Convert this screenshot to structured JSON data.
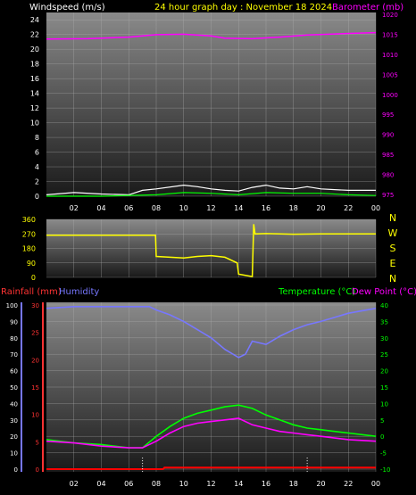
{
  "header": {
    "windspeed_label": "Windspeed (m/s)",
    "graph_title": "24 hour graph day : November 18 2024",
    "barometer_label": "Barometer (mb)"
  },
  "colors": {
    "background": "#000000",
    "wind_speed": "#ffffff",
    "wind_gust": "#00ff00",
    "barometer": "#ff00ff",
    "wind_direction": "#ffff00",
    "rainfall": "#ff0000",
    "humidity": "#7777ff",
    "temperature": "#00ff00",
    "dew_point": "#ff00ff",
    "title": "#ffff00",
    "axis_text": "#ffffff"
  },
  "chart_data": [
    {
      "type": "line",
      "name": "wind-barometer",
      "x_ticks": [
        "02",
        "04",
        "06",
        "08",
        "10",
        "12",
        "14",
        "16",
        "18",
        "20",
        "22",
        "00"
      ],
      "ylabel_left": "Windspeed (m/s)",
      "ylim_left": [
        0,
        25
      ],
      "yticks_left": [
        0,
        2,
        4,
        6,
        8,
        10,
        12,
        14,
        16,
        18,
        20,
        22,
        24
      ],
      "ylabel_right": "Barometer (mb)",
      "ylim_right": [
        975,
        1020
      ],
      "yticks_right": [
        975,
        980,
        985,
        990,
        995,
        1000,
        1005,
        1010,
        1015,
        1020
      ],
      "grid": true,
      "series": [
        {
          "axis": "right",
          "color": "#ff00ff",
          "x": [
            0,
            3,
            6,
            8,
            10,
            12,
            13,
            15,
            17,
            19,
            22,
            24
          ],
          "values": [
            1013.8,
            1013.9,
            1014.3,
            1014.9,
            1015.0,
            1014.6,
            1014.0,
            1013.9,
            1014.3,
            1014.8,
            1015.2,
            1015.4
          ]
        },
        {
          "axis": "left",
          "color": "#ffffff",
          "x": [
            0,
            2,
            4,
            6,
            7,
            8,
            10,
            11,
            12,
            13,
            14,
            15,
            16,
            17,
            18,
            19,
            20,
            22,
            24
          ],
          "values": [
            0.2,
            0.5,
            0.3,
            0.2,
            0.8,
            1.0,
            1.5,
            1.3,
            1.0,
            0.8,
            0.7,
            1.2,
            1.5,
            1.1,
            1.0,
            1.3,
            1.0,
            0.8,
            0.8
          ]
        },
        {
          "axis": "left",
          "color": "#00ff00",
          "x": [
            0,
            4,
            8,
            10,
            12,
            14,
            16,
            18,
            20,
            22,
            24
          ],
          "values": [
            0.0,
            0.0,
            0.2,
            0.5,
            0.4,
            0.2,
            0.5,
            0.4,
            0.4,
            0.2,
            0.1
          ]
        }
      ]
    },
    {
      "type": "line",
      "name": "wind-direction",
      "ylim": [
        0,
        360
      ],
      "yticks": [
        0,
        90,
        180,
        270,
        360
      ],
      "compass": [
        "N",
        "W",
        "S",
        "E",
        "N"
      ],
      "grid": true,
      "series": [
        {
          "color": "#ffff00",
          "x": [
            0,
            7.95,
            8.0,
            9,
            10,
            11,
            12,
            13,
            13.9,
            14,
            15,
            15.1,
            15.2,
            16,
            18,
            20,
            22,
            24
          ],
          "values": [
            262,
            262,
            130,
            125,
            120,
            130,
            135,
            125,
            90,
            20,
            5,
            330,
            270,
            272,
            268,
            270,
            270,
            270
          ]
        }
      ]
    },
    {
      "type": "line",
      "name": "temperature-humidity",
      "x_ticks": [
        "02",
        "04",
        "06",
        "08",
        "10",
        "12",
        "14",
        "16",
        "18",
        "20",
        "22",
        "00"
      ],
      "left_axes": [
        {
          "label": "Rainfall (mm)",
          "ylim": [
            0,
            30
          ],
          "yticks": [
            0,
            5,
            10,
            15,
            20,
            25,
            30
          ]
        },
        {
          "label": "Humidity",
          "ylim": [
            0,
            100
          ],
          "yticks": [
            0,
            10,
            20,
            30,
            40,
            50,
            60,
            70,
            80,
            90,
            100
          ]
        }
      ],
      "right_axis": {
        "label": "Temperature (°C)",
        "label2": "Dew Point (°C)",
        "ylim": [
          -10,
          40
        ],
        "yticks": [
          -10,
          -5,
          0,
          5,
          10,
          15,
          20,
          25,
          30,
          35,
          40
        ]
      },
      "grid": true,
      "series": [
        {
          "name": "Humidity",
          "axis": "humidity",
          "color": "#7777ff",
          "x": [
            0,
            2,
            4,
            6,
            7.5,
            8,
            9,
            10,
            11,
            12,
            13,
            14,
            14.5,
            15,
            16,
            17,
            18,
            19,
            20,
            22,
            24
          ],
          "values": [
            98,
            99,
            99,
            99,
            99,
            97,
            94,
            90,
            85,
            80,
            73,
            68,
            70,
            78,
            76,
            81,
            85,
            88,
            90,
            95,
            98
          ]
        },
        {
          "name": "Temperature (°C)",
          "axis": "temp",
          "color": "#00ff00",
          "x": [
            0,
            2,
            4,
            6,
            7,
            8,
            9,
            10,
            11,
            12,
            13,
            14,
            15,
            16,
            17,
            18,
            19,
            20,
            21,
            22,
            24
          ],
          "values": [
            -1,
            -2,
            -2.5,
            -3.5,
            -3.5,
            0,
            3,
            5.5,
            7,
            8,
            9,
            9.5,
            8.5,
            6.5,
            5,
            3.5,
            2.5,
            2,
            1.5,
            1,
            0
          ]
        },
        {
          "name": "Dew Point (°C)",
          "axis": "temp",
          "color": "#ff00ff",
          "x": [
            0,
            2,
            4,
            6,
            7,
            8,
            9,
            10,
            11,
            12,
            13,
            14,
            15,
            16,
            17,
            18,
            19,
            20,
            22,
            24
          ],
          "values": [
            -1.5,
            -2,
            -3,
            -3.5,
            -3.5,
            -1.5,
            1,
            3,
            4,
            4.5,
            5,
            5.5,
            3.5,
            2.5,
            1.5,
            1,
            0.5,
            0,
            -1,
            -1.5
          ]
        },
        {
          "name": "Rainfall (mm)",
          "axis": "rain",
          "color": "#ff0000",
          "x": [
            0,
            8.5,
            8.6,
            24
          ],
          "values": [
            0,
            0,
            0.3,
            0.3
          ]
        }
      ]
    }
  ]
}
